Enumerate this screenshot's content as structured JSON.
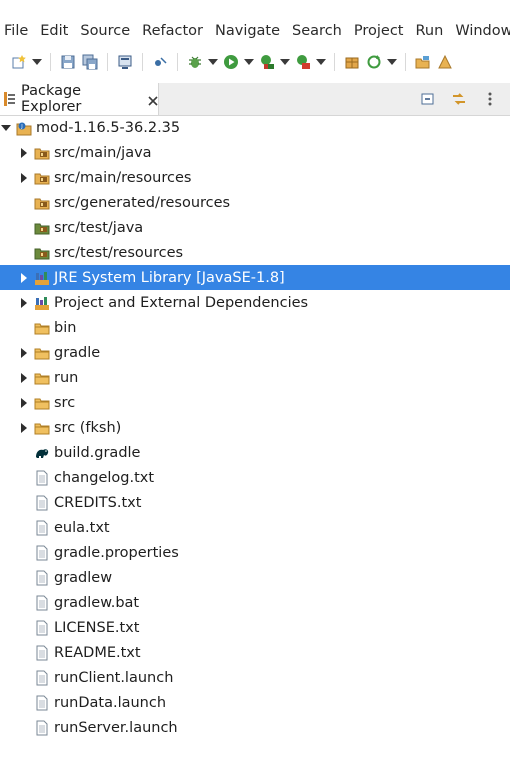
{
  "menubar": {
    "items": [
      "File",
      "Edit",
      "Source",
      "Refactor",
      "Navigate",
      "Search",
      "Project",
      "Run",
      "Window"
    ]
  },
  "toolbar": {
    "icons": [
      "new-icon",
      "save-icon",
      "save-all-icon",
      "terminal-icon",
      "skip-breakpoints-icon",
      "debug-icon",
      "run-icon",
      "coverage-icon",
      "external-tools-icon",
      "new-package-icon",
      "refresh-icon",
      "open-type-icon"
    ]
  },
  "view": {
    "tab_label": "Package Explorer",
    "actions": [
      "collapse-all-icon",
      "link-with-editor-icon",
      "view-menu-icon"
    ]
  },
  "tree": {
    "project": "mod-1.16.5-36.2.35",
    "items": [
      {
        "label": "src/main/java",
        "icon": "source-folder-icon",
        "expandable": true
      },
      {
        "label": "src/main/resources",
        "icon": "source-folder-icon",
        "expandable": true
      },
      {
        "label": "src/generated/resources",
        "icon": "source-folder-icon",
        "expandable": false
      },
      {
        "label": "src/test/java",
        "icon": "test-source-folder-icon",
        "expandable": false
      },
      {
        "label": "src/test/resources",
        "icon": "test-source-folder-icon",
        "expandable": false
      },
      {
        "label": "JRE System Library [JavaSE-1.8]",
        "icon": "library-icon",
        "expandable": true,
        "selected": true
      },
      {
        "label": "Project and External Dependencies",
        "icon": "library-icon",
        "expandable": true
      },
      {
        "label": "bin",
        "icon": "folder-icon",
        "expandable": false
      },
      {
        "label": "gradle",
        "icon": "folder-icon",
        "expandable": true
      },
      {
        "label": "run",
        "icon": "folder-icon",
        "expandable": true
      },
      {
        "label": "src",
        "icon": "folder-icon",
        "expandable": true
      },
      {
        "label": "src (fksh)",
        "icon": "folder-icon",
        "expandable": true
      },
      {
        "label": "build.gradle",
        "icon": "gradle-file-icon",
        "expandable": false
      },
      {
        "label": "changelog.txt",
        "icon": "file-icon",
        "expandable": false
      },
      {
        "label": "CREDITS.txt",
        "icon": "file-icon",
        "expandable": false
      },
      {
        "label": "eula.txt",
        "icon": "file-icon",
        "expandable": false
      },
      {
        "label": "gradle.properties",
        "icon": "file-icon",
        "expandable": false
      },
      {
        "label": "gradlew",
        "icon": "file-icon",
        "expandable": false
      },
      {
        "label": "gradlew.bat",
        "icon": "file-icon",
        "expandable": false
      },
      {
        "label": "LICENSE.txt",
        "icon": "file-icon",
        "expandable": false
      },
      {
        "label": "README.txt",
        "icon": "file-icon",
        "expandable": false
      },
      {
        "label": "runClient.launch",
        "icon": "file-icon",
        "expandable": false
      },
      {
        "label": "runData.launch",
        "icon": "file-icon",
        "expandable": false
      },
      {
        "label": "runServer.launch",
        "icon": "file-icon",
        "expandable": false
      }
    ]
  },
  "colors": {
    "selection": "#3584e4",
    "folder": "#e8b252",
    "view_header": "#eeeeee"
  }
}
